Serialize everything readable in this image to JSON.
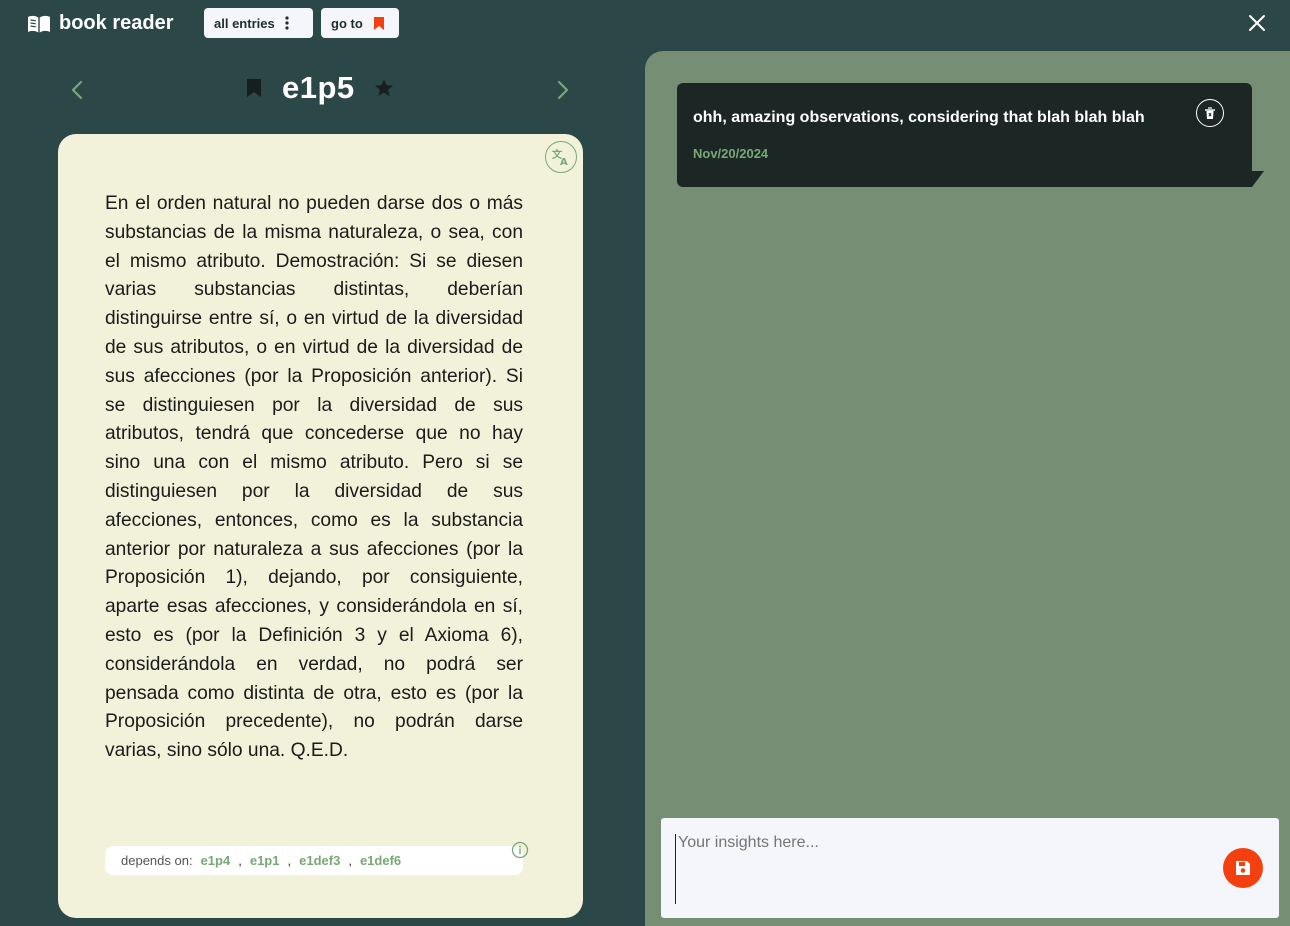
{
  "app": {
    "title": "book reader",
    "logo_icon": "open-book-icon"
  },
  "toolbar": {
    "all_entries_label": "all entries",
    "all_entries_icon": "vertical-dots-icon",
    "goto_label": "go to",
    "goto_icon": "bookmark-icon",
    "close_icon": "close-icon"
  },
  "entry": {
    "title": "e1p5",
    "prev_icon": "chevron-left-icon",
    "next_icon": "chevron-right-icon",
    "bookmark_icon": "bookmark-icon",
    "favorite_icon": "star-icon",
    "translate_icon": "translate-icon",
    "text": "En el orden natural no pueden darse dos o más substancias de la misma naturaleza, o sea, con el mismo atributo. Demostración: Si se diesen varias substancias distintas, deberían distinguirse entre sí, o en virtud de la diversidad de sus atributos, o en virtud de la diversidad de sus afecciones (por la Proposición anterior). Si se distinguiesen por la diversidad de sus atributos, tendrá que concederse que no hay sino una con el mismo atributo. Pero si se distinguiesen por la diversidad de sus afecciones, entonces, como es la substancia anterior por naturaleza a sus afecciones (por la Proposición 1), dejando, por consiguiente, aparte esas afecciones, y considerándola en sí, esto es (por la Definición 3 y el Axioma 6), considerándola en verdad, no podrá ser pensada como distinta de otra, esto es (por la Proposición precedente), no podrán darse varias, sino sólo una. Q.E.D.",
    "depends_label": "depends on:",
    "depends": [
      "e1p4",
      "e1p1",
      "e1def3",
      "e1def6"
    ],
    "depends_separator": ",",
    "info_icon": "info-icon"
  },
  "notes": [
    {
      "text": "ohh, amazing observations, considering that blah blah blah",
      "date": "Nov/20/2024",
      "delete_icon": "trash-icon"
    }
  ],
  "insight": {
    "placeholder": "Your insights here...",
    "value": "",
    "save_icon": "save-icon"
  },
  "colors": {
    "background": "#2c4747",
    "card": "#f1f2d9",
    "panel": "#758e74",
    "note": "#1b2625",
    "accent_green": "#78a876",
    "accent_orange": "#f4400e"
  }
}
